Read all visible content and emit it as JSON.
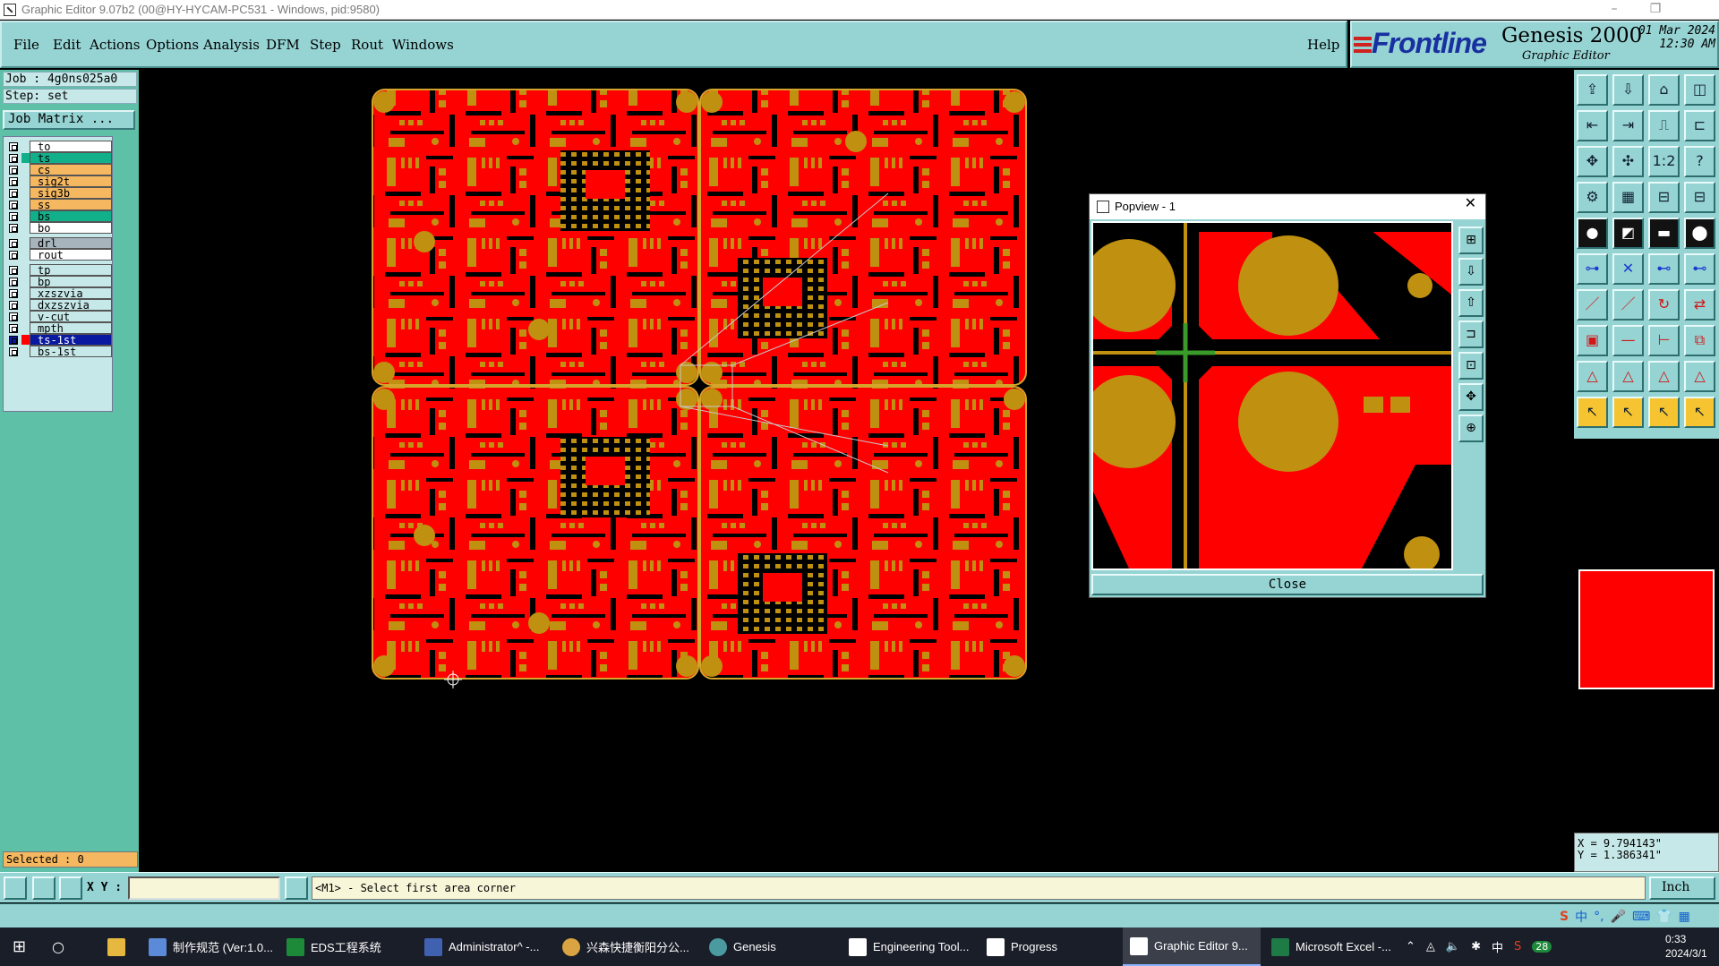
{
  "window": {
    "title": "Graphic Editor 9.07b2 (00@HY-HYCAM-PC531 - Windows, pid:9580)"
  },
  "menu": {
    "items": [
      "File",
      "Edit",
      "Actions",
      "Options",
      "Analysis",
      "DFM",
      "Step",
      "Rout",
      "Windows"
    ],
    "help": "Help"
  },
  "brand": {
    "logo": "Frontline",
    "product": "Genesis 2000",
    "subtitle": "Graphic Editor",
    "date": "01 Mar 2024",
    "time": "12:30 AM"
  },
  "job": {
    "job_line": "Job : 4g0ns025a0",
    "step_line": "Step: set",
    "matrix_button": "Job Matrix ..."
  },
  "layers": [
    {
      "name": "to",
      "color": "#ffffff",
      "checked": false
    },
    {
      "name": "ts",
      "color": "#12b08a",
      "checked": false,
      "swatch": "#12b08a"
    },
    {
      "name": "cs",
      "color": "#f5b860",
      "checked": false
    },
    {
      "name": "sig2t",
      "color": "#f5b860",
      "checked": false
    },
    {
      "name": "sig3b",
      "color": "#f5b860",
      "checked": false
    },
    {
      "name": "ss",
      "color": "#f5b860",
      "checked": false
    },
    {
      "name": "bs",
      "color": "#12b08a",
      "checked": false
    },
    {
      "name": "bo",
      "color": "#ffffff",
      "checked": false
    },
    {
      "name": "drl",
      "color": "#a8b4bc",
      "checked": false
    },
    {
      "name": "rout",
      "color": "#ffffff",
      "checked": false
    },
    {
      "name": "tp",
      "color": "#c6e8e8",
      "checked": false
    },
    {
      "name": "bp",
      "color": "#c6e8e8",
      "checked": false
    },
    {
      "name": "xzszvia",
      "color": "#c6e8e8",
      "checked": false
    },
    {
      "name": "dxzszvia",
      "color": "#c6e8e8",
      "checked": false
    },
    {
      "name": "v-cut",
      "color": "#c6e8e8",
      "checked": false
    },
    {
      "name": "mpth",
      "color": "#c6e8e8",
      "checked": false
    },
    {
      "name": "ts-1st",
      "color": "#0a1aa0",
      "checked": true,
      "swatch": "#ff0000"
    },
    {
      "name": "bs-1st",
      "color": "#c6e8e8",
      "checked": false
    }
  ],
  "selected_text": "Selected : 0",
  "popview": {
    "title": "Popview - 1",
    "close_label": "Close"
  },
  "coords": {
    "x": "X = 9.794143\"",
    "y": "Y = 1.386341\""
  },
  "command": {
    "xy_label": "X Y :",
    "xy_value": "",
    "prompt": "<M1> - Select first area corner",
    "units": "Inch"
  },
  "taskbar": {
    "items": [
      "制作规范 (Ver:1.0...",
      "EDS工程系统",
      "Administrator^ -...",
      "兴森快捷衡阳分公...",
      "Genesis",
      "Engineering Tool...",
      "Progress",
      "Graphic Editor 9...",
      "Microsoft Excel -..."
    ],
    "tray": {
      "lang": "中",
      "badge": "28"
    },
    "clock_time": "0:33",
    "clock_date": "2024/3/1"
  },
  "ime": {
    "lang": "中"
  },
  "colors": {
    "teal": "#96d3d3",
    "panel": "#5fc0a8",
    "copper_red": "#ff0000",
    "pad_gold": "#c09010",
    "board_outline": "#d4a52a"
  }
}
